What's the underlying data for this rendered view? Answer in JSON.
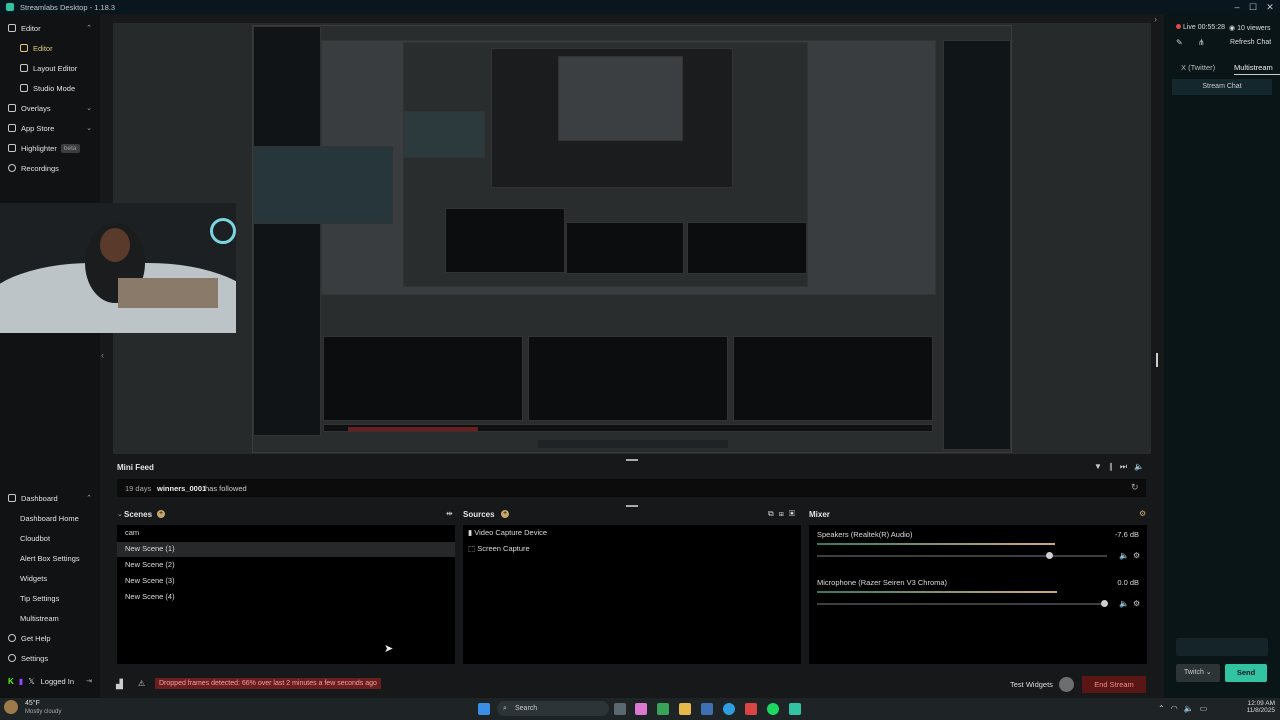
{
  "window": {
    "title": "Streamlabs Desktop - 1.18.3",
    "minimize": "–",
    "maximize": "☐",
    "close": "✕"
  },
  "sidebar": {
    "editor": "Editor",
    "editor_sub": "Editor",
    "layout_editor": "Layout Editor",
    "studio_mode": "Studio Mode",
    "overlays": "Overlays",
    "app_store": "App Store",
    "highlighter": "Highlighter",
    "highlighter_badge": "beta",
    "recordings": "Recordings",
    "dashboard": "Dashboard",
    "dashboard_home": "Dashboard Home",
    "cloudbot": "Cloudbot",
    "alert_box_settings": "Alert Box Settings",
    "widgets": "Widgets",
    "tip_settings": "Tip Settings",
    "multistream": "Multistream",
    "get_help": "Get Help",
    "settings": "Settings",
    "logged_in": "Logged In"
  },
  "chat": {
    "live_time": "Live 00:55:28",
    "viewers": "10 viewers",
    "refresh_chat": "Refresh Chat",
    "tab_x": "X (Twitter)",
    "tab_multistream": "Multistream",
    "stream_chat": "Stream Chat",
    "platform": "Twitch",
    "send": "Send"
  },
  "mini_feed": {
    "title": "Mini Feed",
    "age": "19 days",
    "user": "winners_0001",
    "action": "has followed"
  },
  "scenes": {
    "title": "Scenes",
    "items": [
      "cam",
      "New Scene (1)",
      "New Scene (2)",
      "New Scene (3)",
      "New Scene (4)"
    ]
  },
  "sources": {
    "title": "Sources",
    "items": [
      "Video Capture Device",
      "Screen Capture"
    ]
  },
  "mixer": {
    "title": "Mixer",
    "channels": [
      {
        "name": "Speakers (Realtek(R) Audio)",
        "level": "-7.6 dB",
        "volume": 0.8
      },
      {
        "name": "Microphone (Razer Seiren V3 Chroma)",
        "level": "0.0 dB",
        "volume": 0.99
      }
    ]
  },
  "footer": {
    "warning": "Dropped frames detected: 66% over last 2 minutes a few seconds ago",
    "test_widgets": "Test Widgets",
    "end_stream": "End Stream"
  },
  "taskbar": {
    "temp": "45°F",
    "weather": "Mostly cloudy",
    "search": "Search",
    "time": "12:09 AM",
    "date": "11/8/2025"
  },
  "colors": {
    "accent": "#31c3a2",
    "warning": "#e04848",
    "active": "#e0c77a"
  }
}
